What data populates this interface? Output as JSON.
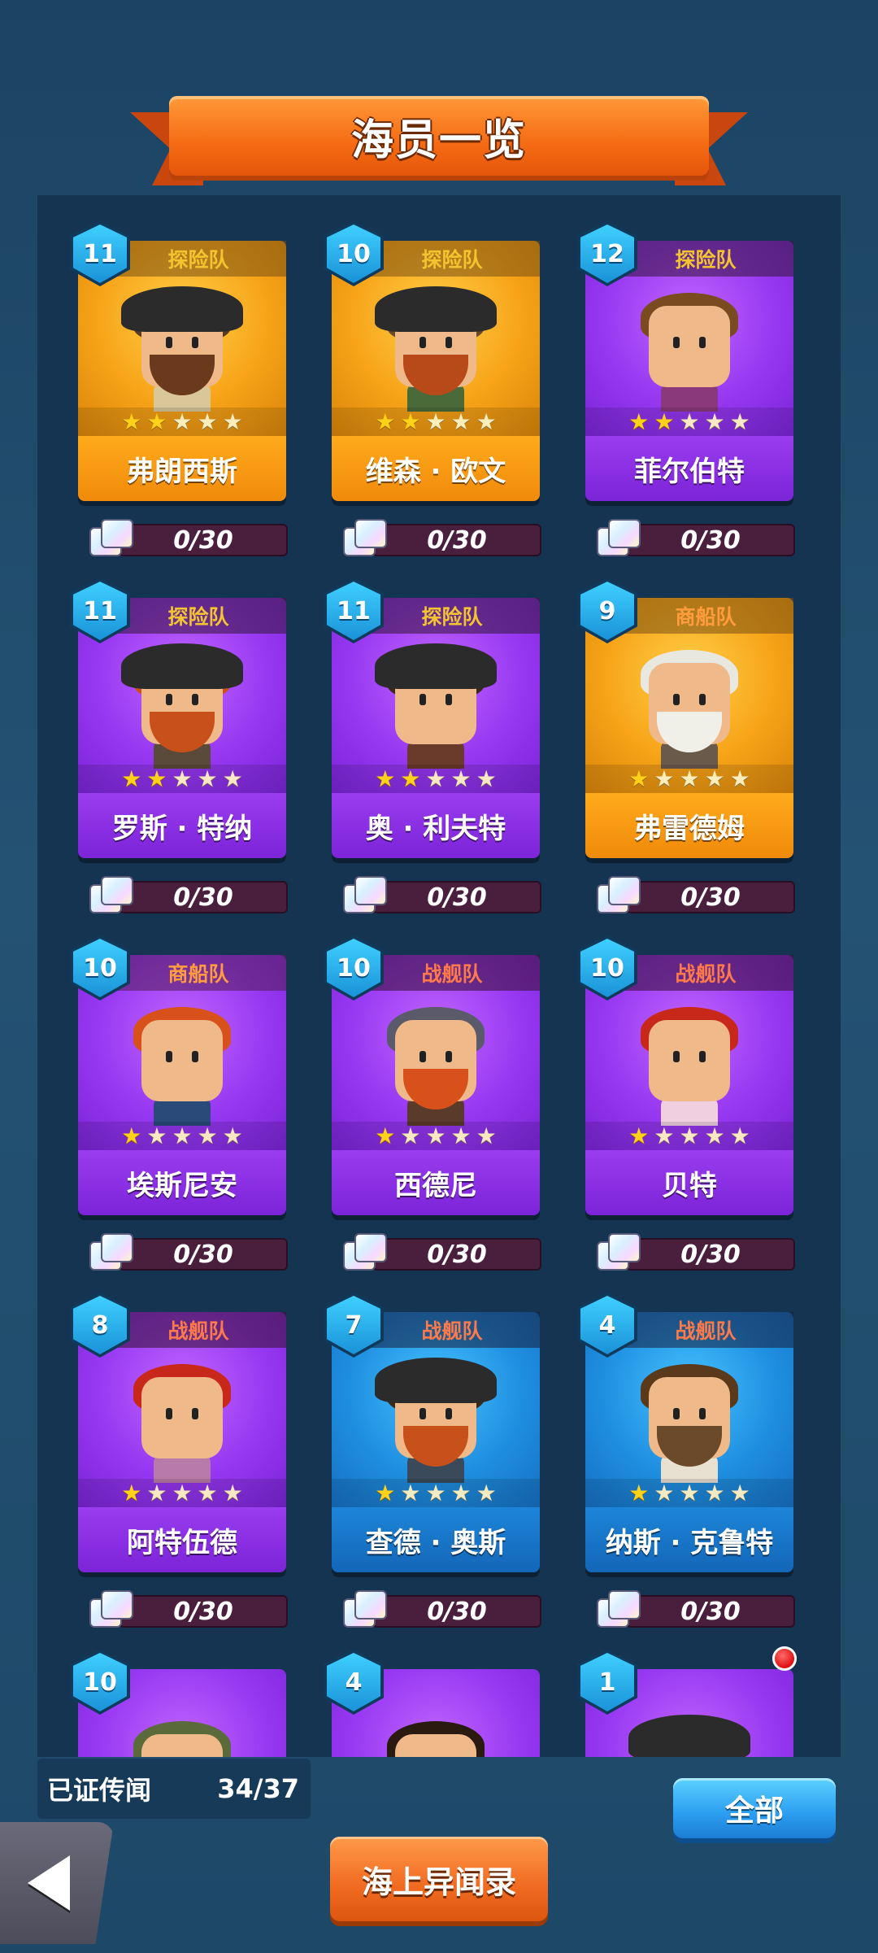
{
  "title": "海员一览",
  "crew": [
    {
      "level": "11",
      "faction": "探险队",
      "faction_type": "explore",
      "name": "弗朗西斯",
      "rarity": "gold",
      "stars": 2,
      "progress": "0/30",
      "hair": "#5a3b22",
      "beard": "#6b3a1c",
      "hat": true,
      "body": "#d9c79a"
    },
    {
      "level": "10",
      "faction": "探险队",
      "faction_type": "explore",
      "name": "维森 · 欧文",
      "rarity": "gold",
      "stars": 2,
      "progress": "0/30",
      "hair": "#6b4a2a",
      "beard": "#b84a1a",
      "hat": true,
      "body": "#4a6a3a"
    },
    {
      "level": "12",
      "faction": "探险队",
      "faction_type": "explore",
      "name": "菲尔伯特",
      "rarity": "purple",
      "stars": 2,
      "progress": "0/30",
      "hair": "#7a4a20",
      "beard": "",
      "hat": false,
      "body": "#8a3a7a"
    },
    {
      "level": "11",
      "faction": "探险队",
      "faction_type": "explore",
      "name": "罗斯 · 特纳",
      "rarity": "purple",
      "stars": 2,
      "progress": "0/30",
      "hair": "#c8501a",
      "beard": "#c8501a",
      "hat": true,
      "body": "#5a4a3a"
    },
    {
      "level": "11",
      "faction": "探险队",
      "faction_type": "explore",
      "name": "奥 · 利夫特",
      "rarity": "purple",
      "stars": 2,
      "progress": "0/30",
      "hair": "#3a2a1a",
      "beard": "",
      "hat": true,
      "body": "#6a3a2a"
    },
    {
      "level": "9",
      "faction": "商船队",
      "faction_type": "merchant",
      "name": "弗雷德姆",
      "rarity": "gold",
      "stars": 1,
      "progress": "0/30",
      "hair": "#e8e8e0",
      "beard": "#f0f0e8",
      "hat": false,
      "body": "#6a5a4a"
    },
    {
      "level": "10",
      "faction": "商船队",
      "faction_type": "merchant",
      "name": "埃斯尼安",
      "rarity": "purple",
      "stars": 1,
      "progress": "0/30",
      "hair": "#d8501a",
      "beard": "",
      "hat": false,
      "body": "#2a4a7a"
    },
    {
      "level": "10",
      "faction": "战舰队",
      "faction_type": "war",
      "name": "西德尼",
      "rarity": "purple",
      "stars": 1,
      "progress": "0/30",
      "hair": "#5a5a6a",
      "beard": "#d8501a",
      "hat": false,
      "body": "#5a3a2a"
    },
    {
      "level": "10",
      "faction": "战舰队",
      "faction_type": "war",
      "name": "贝特",
      "rarity": "purple",
      "stars": 1,
      "progress": "0/30",
      "hair": "#c8281a",
      "beard": "",
      "hat": false,
      "body": "#f0d0e0"
    },
    {
      "level": "8",
      "faction": "战舰队",
      "faction_type": "war",
      "name": "阿特伍德",
      "rarity": "purple",
      "stars": 1,
      "progress": "0/30",
      "hair": "#c8281a",
      "beard": "",
      "hat": false,
      "body": "#b87aa8"
    },
    {
      "level": "7",
      "faction": "战舰队",
      "faction_type": "war",
      "name": "查德 · 奥斯",
      "rarity": "blue",
      "stars": 1,
      "progress": "0/30",
      "hair": "#3a2a1a",
      "beard": "#c8501a",
      "hat": true,
      "body": "#3a4a5a"
    },
    {
      "level": "4",
      "faction": "战舰队",
      "faction_type": "war",
      "name": "纳斯 · 克鲁特",
      "rarity": "blue",
      "stars": 1,
      "progress": "0/30",
      "hair": "#5a3a1a",
      "beard": "#6a4a2a",
      "hat": false,
      "body": "#e8e0d0"
    },
    {
      "level": "10",
      "faction": "",
      "faction_type": "",
      "name": "",
      "rarity": "purple",
      "stars": 0,
      "progress": "",
      "hair": "#5a6a3a",
      "beard": "",
      "hat": false,
      "body": "#8a6a4a"
    },
    {
      "level": "4",
      "faction": "",
      "faction_type": "",
      "name": "",
      "rarity": "purple",
      "stars": 0,
      "progress": "",
      "hair": "#2a1a10",
      "beard": "",
      "hat": false,
      "body": "#6a3a2a"
    },
    {
      "level": "1",
      "faction": "",
      "faction_type": "",
      "name": "",
      "rarity": "purple",
      "stars": 0,
      "progress": "",
      "hair": "#d88a8a",
      "beard": "",
      "hat": true,
      "body": "#3a2a1a",
      "notification": true
    }
  ],
  "legend": {
    "label": "已证传闻",
    "count": "34/37"
  },
  "buttons": {
    "all": "全部",
    "log": "海上异闻录"
  },
  "icons": {
    "back": "back-arrow-icon",
    "puzzle": "puzzle-piece-icon",
    "star": "star-icon"
  }
}
